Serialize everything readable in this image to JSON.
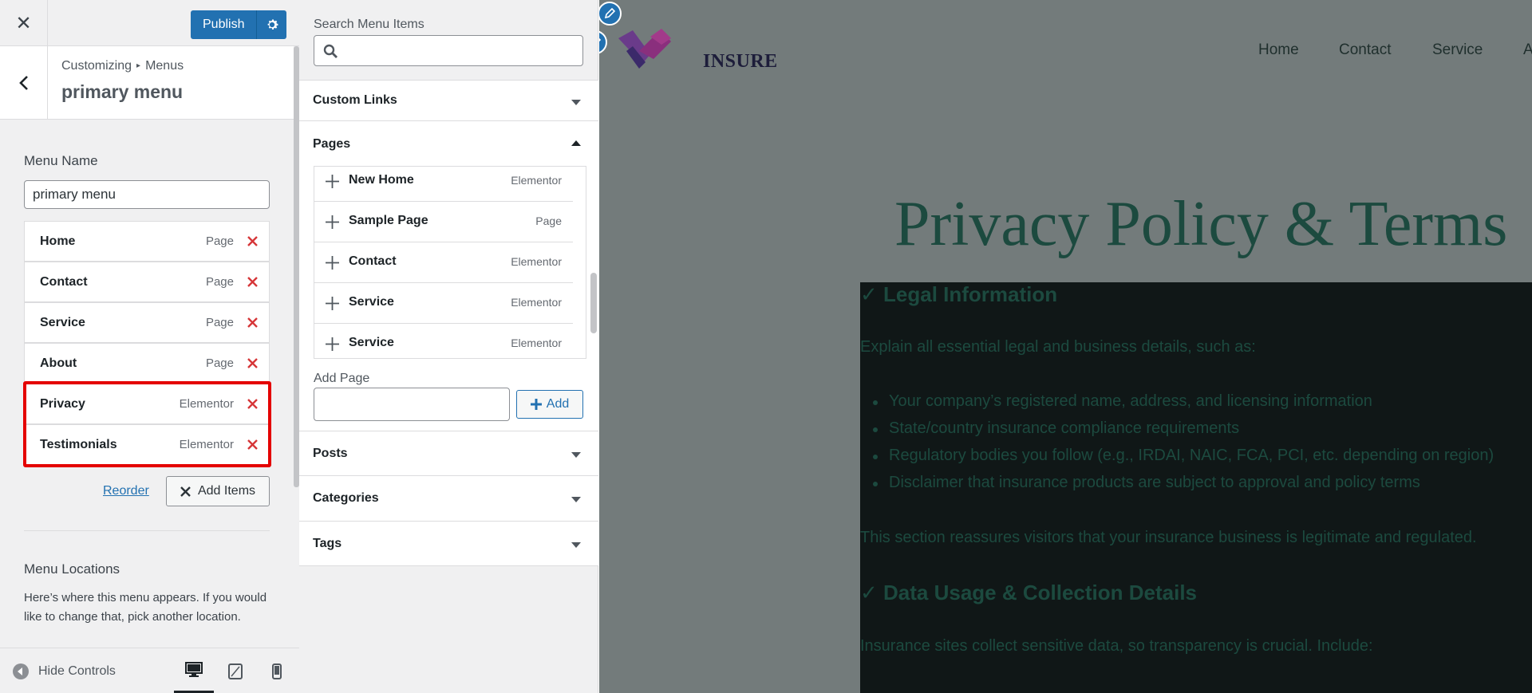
{
  "topbar": {
    "close_icon": "close-icon",
    "publish_label": "Publish",
    "settings_icon": "gear-icon"
  },
  "panel": {
    "breadcrumb_parent": "Customizing",
    "breadcrumb_child": "Menus",
    "title": "primary menu",
    "menu_name_label": "Menu Name",
    "menu_name_value": "primary menu",
    "menu_items": [
      {
        "title": "Home",
        "type": "Page"
      },
      {
        "title": "Contact",
        "type": "Page"
      },
      {
        "title": "Service",
        "type": "Page"
      },
      {
        "title": "About",
        "type": "Page"
      },
      {
        "title": "Privacy",
        "type": "Elementor"
      },
      {
        "title": "Testimonials",
        "type": "Elementor"
      }
    ],
    "reorder_label": "Reorder",
    "add_items_label": "Add Items",
    "locations_title": "Menu Locations",
    "locations_desc": "Here’s where this menu appears. If you would like to change that, pick another location."
  },
  "footer": {
    "hide_controls_label": "Hide Controls"
  },
  "available": {
    "search_label": "Search Menu Items",
    "search_value": "",
    "sections": {
      "custom_links": "Custom Links",
      "pages": "Pages",
      "posts": "Posts",
      "categories": "Categories",
      "tags": "Tags"
    },
    "pages": [
      {
        "title": "New Home",
        "type": "Elementor"
      },
      {
        "title": "Sample Page",
        "type": "Page"
      },
      {
        "title": "Contact",
        "type": "Elementor"
      },
      {
        "title": "Service",
        "type": "Elementor"
      },
      {
        "title": "Service",
        "type": "Elementor"
      }
    ],
    "add_page_label": "Add Page",
    "add_page_value": "",
    "add_button": "Add"
  },
  "preview": {
    "logo_text": "INSURE",
    "nav": [
      "Home",
      "Contact",
      "Service",
      "A"
    ],
    "hero_title": "Privacy Policy & Terms",
    "heading_1": "✓ Legal Information",
    "para_1": "Explain all essential legal and business details, such as:",
    "bullets": [
      "Your company’s registered name, address, and licensing information",
      "State/country insurance compliance requirements",
      "Regulatory bodies you follow (e.g., IRDAI, NAIC, FCA, PCI, etc. depending on region)",
      "Disclaimer that insurance products are subject to approval and policy terms"
    ],
    "para_2": "This section reassures visitors that your insurance business is legitimate and regulated.",
    "heading_2": "✓ Data Usage & Collection Details",
    "para_3": "Insurance sites collect sensitive data, so transparency is crucial. Include:"
  },
  "colors": {
    "accent": "#2271b1",
    "delete": "#d63638",
    "highlight": "#e40000",
    "preview_overlay": "#737b7b",
    "heading_green": "#1c4a3f"
  }
}
